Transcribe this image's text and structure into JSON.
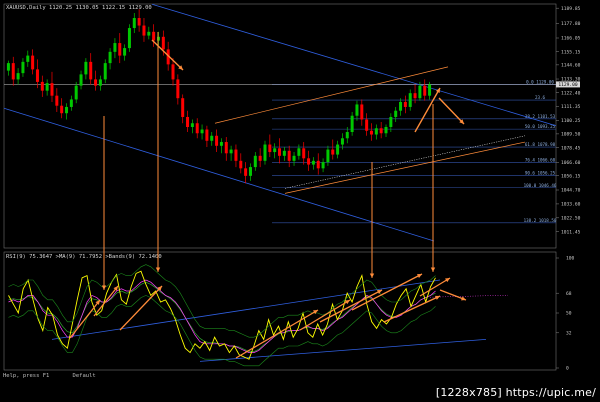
{
  "chart_data": [
    {
      "type": "candlestick",
      "title": "XAUUSD,Daily  1120.25 1130.05 1122.15 1129.00",
      "ylim": [
        1000,
        1190
      ],
      "y_ticks": [
        "1189.85",
        "1177.80",
        "1166.05",
        "1155.15",
        "1144.60",
        "1133.30",
        "1122.40",
        "1111.35",
        "1100.25",
        "1089.50",
        "1078.45",
        "1066.60",
        "1056.15",
        "1044.70",
        "1033.60",
        "1022.50",
        "1011.45"
      ],
      "current_price": "1129.00",
      "fib_levels": [
        {
          "label": "0.0 1129.00",
          "value": 1129.0
        },
        {
          "label": "23.6",
          "value": 1116.5
        },
        {
          "label": "38.2 1101.53",
          "value": 1101.5
        },
        {
          "label": "50.0 1093.25",
          "value": 1093.3
        },
        {
          "label": "61.8 1078.98",
          "value": 1079.0
        },
        {
          "label": "76.4 1066.60",
          "value": 1066.6
        },
        {
          "label": "90.6 1056.25",
          "value": 1056.3
        },
        {
          "label": "100.0 1046.46",
          "value": 1046.5
        },
        {
          "label": "138.2 1018.50",
          "value": 1018.5
        }
      ],
      "candles": [
        {
          "o": 1140,
          "h": 1148,
          "c": 1146,
          "l": 1136
        },
        {
          "o": 1146,
          "h": 1151,
          "c": 1133,
          "l": 1128
        },
        {
          "o": 1133,
          "h": 1142,
          "c": 1138,
          "l": 1129
        },
        {
          "o": 1138,
          "h": 1150,
          "c": 1147,
          "l": 1135
        },
        {
          "o": 1147,
          "h": 1156,
          "c": 1152,
          "l": 1143
        },
        {
          "o": 1152,
          "h": 1157,
          "c": 1141,
          "l": 1137
        },
        {
          "o": 1141,
          "h": 1149,
          "c": 1131,
          "l": 1126
        },
        {
          "o": 1131,
          "h": 1136,
          "c": 1124,
          "l": 1119
        },
        {
          "o": 1124,
          "h": 1133,
          "c": 1130,
          "l": 1120
        },
        {
          "o": 1130,
          "h": 1139,
          "c": 1120,
          "l": 1115
        },
        {
          "o": 1120,
          "h": 1126,
          "c": 1112,
          "l": 1107
        },
        {
          "o": 1112,
          "h": 1118,
          "c": 1106,
          "l": 1102
        },
        {
          "o": 1106,
          "h": 1114,
          "c": 1111,
          "l": 1101
        },
        {
          "o": 1111,
          "h": 1120,
          "c": 1117,
          "l": 1108
        },
        {
          "o": 1117,
          "h": 1131,
          "c": 1128,
          "l": 1114
        },
        {
          "o": 1128,
          "h": 1140,
          "c": 1137,
          "l": 1125
        },
        {
          "o": 1137,
          "h": 1150,
          "c": 1147,
          "l": 1133
        },
        {
          "o": 1147,
          "h": 1154,
          "c": 1133,
          "l": 1129
        },
        {
          "o": 1133,
          "h": 1140,
          "c": 1128,
          "l": 1124
        },
        {
          "o": 1128,
          "h": 1136,
          "c": 1133,
          "l": 1124
        },
        {
          "o": 1133,
          "h": 1149,
          "c": 1146,
          "l": 1130
        },
        {
          "o": 1146,
          "h": 1158,
          "c": 1155,
          "l": 1141
        },
        {
          "o": 1155,
          "h": 1166,
          "c": 1162,
          "l": 1150
        },
        {
          "o": 1162,
          "h": 1170,
          "c": 1152,
          "l": 1146
        },
        {
          "o": 1152,
          "h": 1161,
          "c": 1158,
          "l": 1148
        },
        {
          "o": 1158,
          "h": 1177,
          "c": 1174,
          "l": 1155
        },
        {
          "o": 1174,
          "h": 1186,
          "c": 1182,
          "l": 1170
        },
        {
          "o": 1182,
          "h": 1189,
          "c": 1176,
          "l": 1171
        },
        {
          "o": 1176,
          "h": 1182,
          "c": 1168,
          "l": 1163
        },
        {
          "o": 1168,
          "h": 1175,
          "c": 1171,
          "l": 1165
        },
        {
          "o": 1171,
          "h": 1177,
          "c": 1164,
          "l": 1159
        },
        {
          "o": 1164,
          "h": 1171,
          "c": 1167,
          "l": 1160
        },
        {
          "o": 1167,
          "h": 1172,
          "c": 1157,
          "l": 1152
        },
        {
          "o": 1157,
          "h": 1163,
          "c": 1145,
          "l": 1140
        },
        {
          "o": 1145,
          "h": 1150,
          "c": 1133,
          "l": 1128
        },
        {
          "o": 1133,
          "h": 1137,
          "c": 1118,
          "l": 1113
        },
        {
          "o": 1118,
          "h": 1121,
          "c": 1103,
          "l": 1098
        },
        {
          "o": 1103,
          "h": 1108,
          "c": 1095,
          "l": 1091
        },
        {
          "o": 1095,
          "h": 1101,
          "c": 1098,
          "l": 1090
        },
        {
          "o": 1098,
          "h": 1102,
          "c": 1090,
          "l": 1086
        },
        {
          "o": 1090,
          "h": 1097,
          "c": 1093,
          "l": 1085
        },
        {
          "o": 1093,
          "h": 1096,
          "c": 1084,
          "l": 1079
        },
        {
          "o": 1084,
          "h": 1091,
          "c": 1088,
          "l": 1080
        },
        {
          "o": 1088,
          "h": 1093,
          "c": 1080,
          "l": 1075
        },
        {
          "o": 1080,
          "h": 1086,
          "c": 1083,
          "l": 1074
        },
        {
          "o": 1083,
          "h": 1087,
          "c": 1074,
          "l": 1068
        },
        {
          "o": 1074,
          "h": 1080,
          "c": 1077,
          "l": 1068
        },
        {
          "o": 1077,
          "h": 1081,
          "c": 1068,
          "l": 1063
        },
        {
          "o": 1068,
          "h": 1074,
          "c": 1062,
          "l": 1058
        },
        {
          "o": 1062,
          "h": 1067,
          "c": 1056,
          "l": 1050
        },
        {
          "o": 1056,
          "h": 1066,
          "c": 1063,
          "l": 1052
        },
        {
          "o": 1063,
          "h": 1075,
          "c": 1072,
          "l": 1060
        },
        {
          "o": 1072,
          "h": 1078,
          "c": 1068,
          "l": 1063
        },
        {
          "o": 1068,
          "h": 1084,
          "c": 1081,
          "l": 1065
        },
        {
          "o": 1081,
          "h": 1089,
          "c": 1075,
          "l": 1071
        },
        {
          "o": 1075,
          "h": 1082,
          "c": 1078,
          "l": 1070
        },
        {
          "o": 1078,
          "h": 1086,
          "c": 1072,
          "l": 1066
        },
        {
          "o": 1072,
          "h": 1079,
          "c": 1076,
          "l": 1068
        },
        {
          "o": 1076,
          "h": 1080,
          "c": 1068,
          "l": 1063
        },
        {
          "o": 1068,
          "h": 1075,
          "c": 1072,
          "l": 1064
        },
        {
          "o": 1072,
          "h": 1081,
          "c": 1078,
          "l": 1069
        },
        {
          "o": 1078,
          "h": 1083,
          "c": 1070,
          "l": 1065
        },
        {
          "o": 1070,
          "h": 1076,
          "c": 1065,
          "l": 1060
        },
        {
          "o": 1065,
          "h": 1071,
          "c": 1068,
          "l": 1061
        },
        {
          "o": 1068,
          "h": 1074,
          "c": 1062,
          "l": 1057
        },
        {
          "o": 1062,
          "h": 1070,
          "c": 1067,
          "l": 1059
        },
        {
          "o": 1067,
          "h": 1080,
          "c": 1077,
          "l": 1064
        },
        {
          "o": 1077,
          "h": 1085,
          "c": 1073,
          "l": 1069
        },
        {
          "o": 1073,
          "h": 1084,
          "c": 1081,
          "l": 1070
        },
        {
          "o": 1081,
          "h": 1090,
          "c": 1086,
          "l": 1077
        },
        {
          "o": 1086,
          "h": 1095,
          "c": 1091,
          "l": 1082
        },
        {
          "o": 1091,
          "h": 1107,
          "c": 1104,
          "l": 1088
        },
        {
          "o": 1104,
          "h": 1116,
          "c": 1113,
          "l": 1100
        },
        {
          "o": 1113,
          "h": 1117,
          "c": 1101,
          "l": 1096
        },
        {
          "o": 1101,
          "h": 1106,
          "c": 1092,
          "l": 1088
        },
        {
          "o": 1092,
          "h": 1098,
          "c": 1089,
          "l": 1084
        },
        {
          "o": 1089,
          "h": 1097,
          "c": 1094,
          "l": 1085
        },
        {
          "o": 1094,
          "h": 1099,
          "c": 1090,
          "l": 1086
        },
        {
          "o": 1090,
          "h": 1097,
          "c": 1095,
          "l": 1087
        },
        {
          "o": 1095,
          "h": 1106,
          "c": 1103,
          "l": 1091
        },
        {
          "o": 1103,
          "h": 1111,
          "c": 1108,
          "l": 1099
        },
        {
          "o": 1108,
          "h": 1118,
          "c": 1115,
          "l": 1104
        },
        {
          "o": 1115,
          "h": 1120,
          "c": 1111,
          "l": 1106
        },
        {
          "o": 1111,
          "h": 1125,
          "c": 1122,
          "l": 1108
        },
        {
          "o": 1122,
          "h": 1129,
          "c": 1118,
          "l": 1114
        },
        {
          "o": 1118,
          "h": 1131,
          "c": 1128,
          "l": 1116
        },
        {
          "o": 1128,
          "h": 1133,
          "c": 1120,
          "l": 1116
        },
        {
          "o": 1120,
          "h": 1131,
          "c": 1129,
          "l": 1117
        }
      ],
      "bull_color": "#00c800",
      "bear_color": "#ff0000"
    },
    {
      "type": "line",
      "title": "RSI(9) 75.3647  >MA(9) 71.7952  >Bands(9) 72.1400",
      "ylim": [
        0,
        100
      ],
      "y_ticks": [
        "100",
        "68",
        "50",
        "32",
        "0"
      ],
      "series": [
        {
          "values": [
            66,
            58,
            50,
            72,
            80,
            62,
            45,
            34,
            55,
            48,
            30,
            22,
            18,
            40,
            62,
            82,
            84,
            60,
            48,
            52,
            68,
            78,
            85,
            62,
            58,
            74,
            86,
            88,
            76,
            66,
            70,
            60,
            62,
            54,
            44,
            30,
            18,
            14,
            22,
            18,
            24,
            16,
            28,
            20,
            22,
            14,
            20,
            12,
            10,
            8,
            20,
            34,
            26,
            44,
            30,
            38,
            26,
            42,
            28,
            36,
            50,
            32,
            28,
            40,
            30,
            40,
            58,
            44,
            52,
            68,
            60,
            74,
            84,
            58,
            42,
            36,
            44,
            40,
            46,
            58,
            66,
            72,
            56,
            66,
            76,
            60,
            74,
            82
          ]
        },
        {
          "values": [
            60,
            62,
            60,
            62,
            66,
            66,
            60,
            52,
            48,
            48,
            42,
            34,
            28,
            28,
            36,
            48,
            60,
            66,
            64,
            60,
            60,
            64,
            70,
            72,
            70,
            70,
            74,
            78,
            80,
            78,
            74,
            70,
            66,
            64,
            60,
            54,
            46,
            38,
            30,
            24,
            22,
            22,
            22,
            22,
            22,
            20,
            20,
            18,
            16,
            14,
            14,
            16,
            20,
            24,
            28,
            32,
            32,
            34,
            34,
            34,
            36,
            38,
            36,
            36,
            34,
            36,
            40,
            44,
            46,
            50,
            54,
            58,
            62,
            66,
            64,
            58,
            52,
            48,
            46,
            46,
            48,
            52,
            56,
            58,
            62,
            64,
            66,
            70
          ]
        },
        {
          "values": [
            62,
            63,
            62,
            63,
            65,
            64,
            60,
            54,
            50,
            49,
            45,
            38,
            33,
            32,
            38,
            48,
            58,
            63,
            62,
            60,
            60,
            63,
            68,
            70,
            68,
            69,
            72,
            76,
            78,
            76,
            73,
            69,
            66,
            63,
            59,
            53,
            46,
            39,
            32,
            27,
            24,
            23,
            23,
            22,
            22,
            20,
            20,
            19,
            17,
            15,
            15,
            17,
            21,
            24,
            28,
            31,
            32,
            33,
            34,
            34,
            36,
            37,
            36,
            36,
            35,
            37,
            41,
            44,
            47,
            51,
            55,
            58,
            62,
            65,
            63,
            58,
            53,
            49,
            47,
            47,
            49,
            52,
            56,
            58,
            62,
            64,
            66,
            68
          ]
        }
      ],
      "band_upper_color": "#1c8a1c"
    }
  ],
  "status_bar": {
    "text": "Help, press F1       Default"
  },
  "watermark": {
    "text": "[1228x785] https://upic.me/"
  },
  "colors": {
    "axis_box": "#707070",
    "blue_line": "#2f5fe0",
    "orange_arrow": "#ff8c3a",
    "fib_line": "#3355aa",
    "rsi_line": "#ffff00",
    "rsi_ma": "#ff40ff",
    "rsi_bands": "#2ea82e"
  }
}
